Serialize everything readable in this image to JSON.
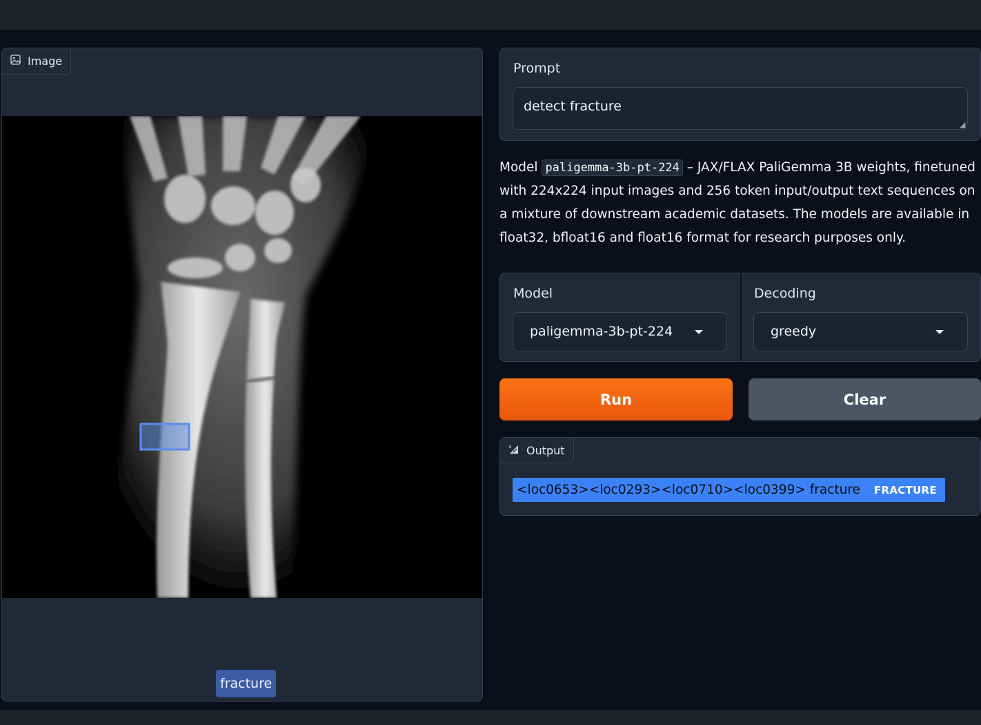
{
  "image_panel": {
    "label": "Image",
    "detection_label": "fracture"
  },
  "prompt": {
    "label": "Prompt",
    "value": "detect fracture"
  },
  "description": {
    "prefix": "Model",
    "model_code": "paligemma-3b-pt-224",
    "text": " – JAX/FLAX PaliGemma 3B weights, finetuned with 224x224 input images and 256 token input/output text sequences on a mixture of downstream academic datasets. The models are available in float32, bfloat16 and float16 format for research purposes only."
  },
  "model_select": {
    "label": "Model",
    "value": "paligemma-3b-pt-224"
  },
  "decoding_select": {
    "label": "Decoding",
    "value": "greedy"
  },
  "buttons": {
    "run": "Run",
    "clear": "Clear"
  },
  "output": {
    "label": "Output",
    "text": "<loc0653><loc0293><loc0710><loc0399> fracture",
    "badge": "FRACTURE"
  },
  "colors": {
    "accent_run": "#f97316",
    "highlight": "#3b82f6",
    "detection_box": "#5b8cf0"
  }
}
